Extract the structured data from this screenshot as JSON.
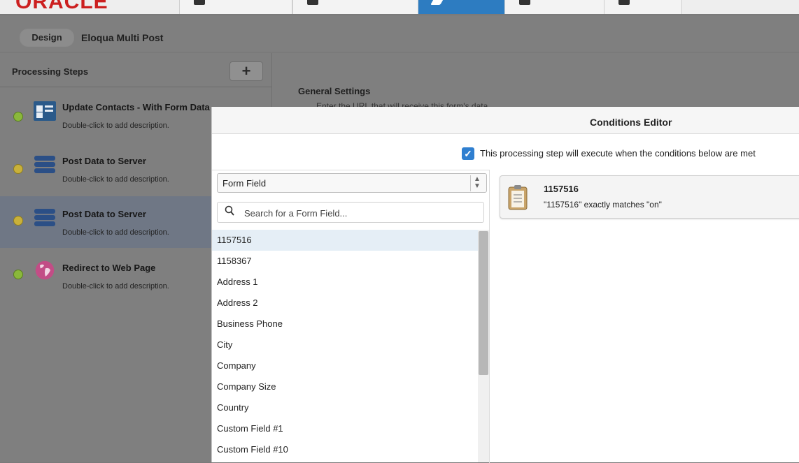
{
  "brand": {
    "logo_text": "ORACLE",
    "accent": "#2d7cc1",
    "logo_color": "#cc1f1f"
  },
  "topnav": {
    "tabs": [
      {
        "icon": "home-icon"
      },
      {
        "icon": "orders-icon"
      },
      {
        "icon": "wrench-icon",
        "active": true
      },
      {
        "icon": "page-icon"
      },
      {
        "icon": "reports-icon"
      }
    ]
  },
  "breadcrumb": {
    "mode": "Design",
    "title": "Eloqua Multi Post"
  },
  "processing_steps": {
    "title": "Processing Steps",
    "add_label": "+",
    "items": [
      {
        "name": "Update Contacts - With Form Data",
        "desc": "Double-click to add description.",
        "icon": "contact-card-icon",
        "status": "green"
      },
      {
        "name": "Post Data to Server",
        "desc": "Double-click to add description.",
        "icon": "server-icon",
        "status": "yellow"
      },
      {
        "name": "Post Data to Server",
        "desc": "Double-click to add description.",
        "icon": "server-icon",
        "status": "yellow",
        "selected": true
      },
      {
        "name": "Redirect to Web Page",
        "desc": "Double-click to add description.",
        "icon": "globe-icon",
        "status": "green"
      }
    ]
  },
  "general_settings": {
    "title": "General Settings",
    "subtitle": "Enter the URL that will receive this form's data"
  },
  "conditions_editor": {
    "title": "Conditions Editor",
    "execute_checked": true,
    "execute_label": "This processing step will execute when the conditions below are met",
    "field_type": "Form Field",
    "search_placeholder": "Search for a Form Field...",
    "fields": [
      "1157516",
      "1158367",
      "Address 1",
      "Address 2",
      "Business Phone",
      "City",
      "Company",
      "Company Size",
      "Country",
      "Custom Field #1",
      "Custom Field #10"
    ],
    "selected_field": "1157516",
    "condition": {
      "title": "1157516",
      "description": "\"1157516\" exactly matches \"on\""
    }
  }
}
